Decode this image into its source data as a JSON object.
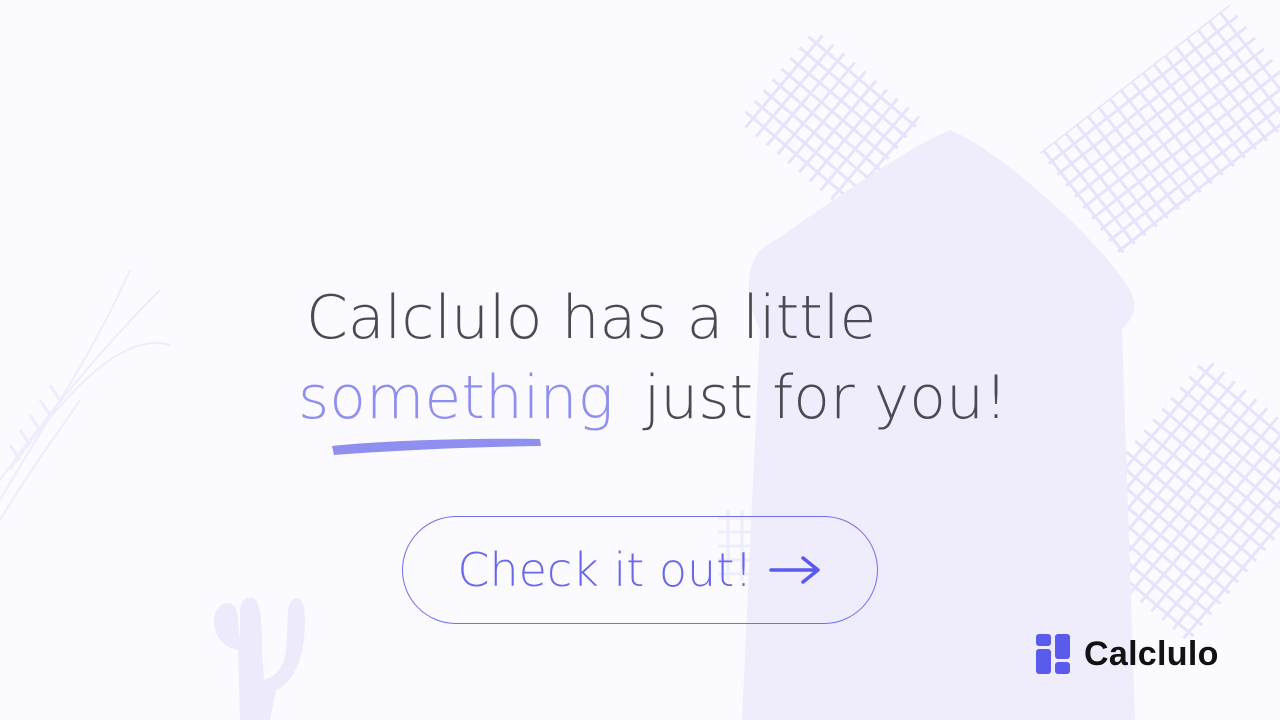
{
  "headline": {
    "line1": "Calclulo has a little",
    "highlight": "something",
    "line2_rest": "just for you!"
  },
  "cta": {
    "label": "Check it out!",
    "icon": "arrow-right-icon"
  },
  "brand": {
    "name": "Calclulo",
    "icon": "calclulo-logo-icon"
  },
  "colors": {
    "background": "#fbfaff",
    "accent": "#6868ee",
    "highlight": "#8f8ff0",
    "text": "#4a4a50",
    "art": "#efedfc"
  }
}
